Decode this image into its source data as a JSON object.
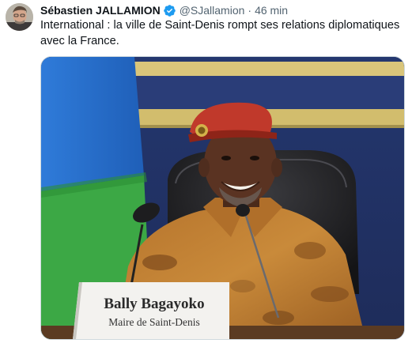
{
  "author": {
    "name": "Sébastien JALLAMION",
    "handle": "@SJallamion",
    "separator": "·",
    "time": "46 min"
  },
  "icons": {
    "verified": "verified-badge-icon",
    "avatar": "profile-photo"
  },
  "tweet_text": "International : la ville de Saint-Denis rompt ses relations diplomatiques avec la France.",
  "media": {
    "placard_name": "Bally Bagayoko",
    "placard_title": "Maire de Saint-Denis"
  },
  "colors": {
    "verified_blue": "#1d9bf0",
    "secondary_text": "#536471",
    "beret_red": "#c0392b"
  }
}
